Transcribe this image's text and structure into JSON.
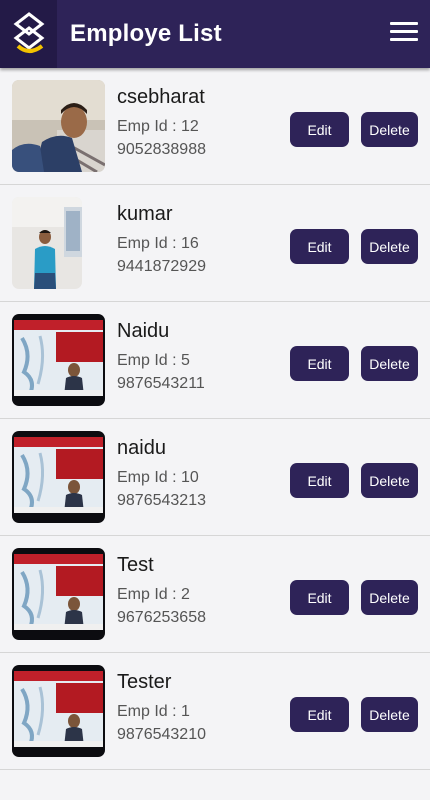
{
  "header": {
    "title": "Employe List"
  },
  "employees": [
    {
      "name": "csebharat",
      "emp_id": "Emp Id : 12",
      "phone": "9052838988",
      "photo": "person-selfie"
    },
    {
      "name": "kumar",
      "emp_id": "Emp Id : 16",
      "phone": "9441872929",
      "photo": "person-standing"
    },
    {
      "name": "Naidu",
      "emp_id": "Emp Id : 5",
      "phone": "9876543211",
      "photo": "tv-news"
    },
    {
      "name": "naidu",
      "emp_id": "Emp Id : 10",
      "phone": "9876543213",
      "photo": "tv-news"
    },
    {
      "name": "Test",
      "emp_id": "Emp Id : 2",
      "phone": "9676253658",
      "photo": "tv-news"
    },
    {
      "name": "Tester",
      "emp_id": "Emp Id : 1",
      "phone": "9876543210",
      "photo": "tv-news"
    }
  ],
  "actions": {
    "edit_label": "Edit",
    "delete_label": "Delete"
  },
  "colors": {
    "primary": "#2e2358",
    "logo_bg": "#231a47",
    "accent_yellow": "#f2c200"
  }
}
